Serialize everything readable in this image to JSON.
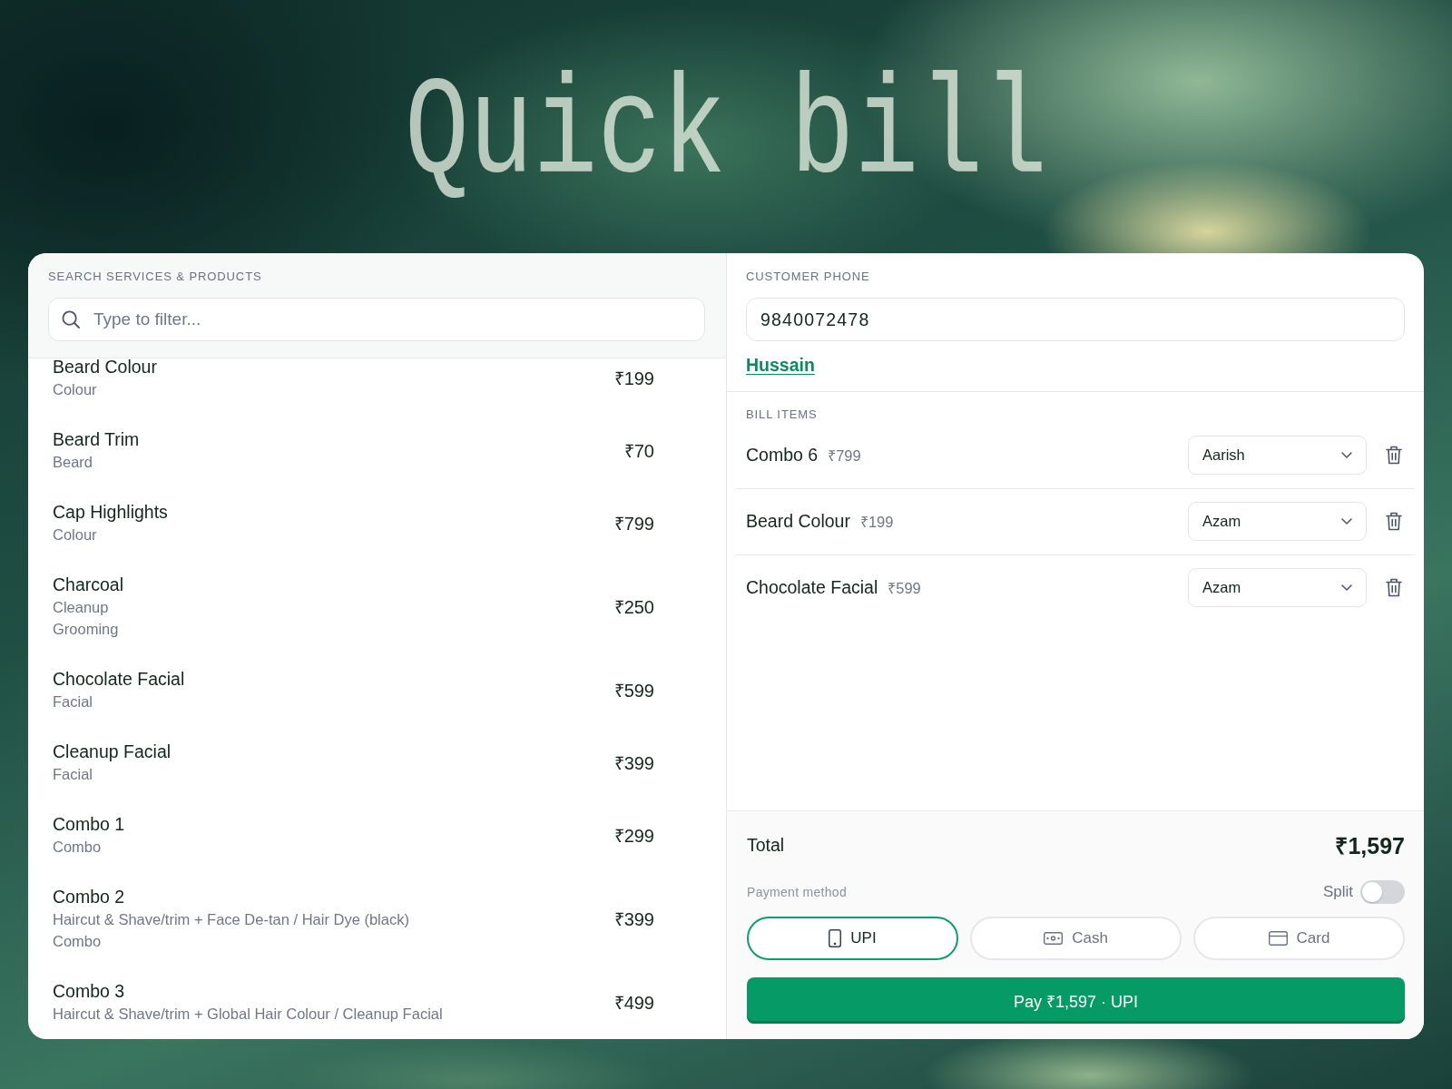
{
  "title": "Quick bill",
  "search_panel": {
    "label": "SEARCH SERVICES & PRODUCTS",
    "search": {
      "placeholder": "Type to filter..."
    },
    "items": [
      {
        "name": "Beard Colour",
        "details": [
          "Colour"
        ],
        "price": "₹199"
      },
      {
        "name": "Beard Trim",
        "details": [
          "Beard"
        ],
        "price": "₹70"
      },
      {
        "name": "Cap Highlights",
        "details": [
          "Colour"
        ],
        "price": "₹799"
      },
      {
        "name": "Charcoal",
        "details": [
          "Cleanup",
          "Grooming"
        ],
        "price": "₹250"
      },
      {
        "name": "Chocolate Facial",
        "details": [
          "Facial"
        ],
        "price": "₹599"
      },
      {
        "name": "Cleanup Facial",
        "details": [
          "Facial"
        ],
        "price": "₹399"
      },
      {
        "name": "Combo 1",
        "details": [
          "Combo"
        ],
        "price": "₹299"
      },
      {
        "name": "Combo 2",
        "details": [
          "Haircut & Shave/trim + Face De-tan / Hair Dye (black)",
          "Combo"
        ],
        "price": "₹399"
      },
      {
        "name": "Combo 3",
        "details": [
          "Haircut & Shave/trim + Global Hair Colour / Cleanup Facial"
        ],
        "price": "₹499"
      }
    ]
  },
  "bill_panel": {
    "customer": {
      "label": "CUSTOMER PHONE",
      "phone": "9840072478",
      "name": "Hussain"
    },
    "items_label": "BILL ITEMS",
    "items": [
      {
        "name": "Combo 6",
        "price": "₹799",
        "staff": "Aarish"
      },
      {
        "name": "Beard Colour",
        "price": "₹199",
        "staff": "Azam"
      },
      {
        "name": "Chocolate Facial",
        "price": "₹599",
        "staff": "Azam"
      }
    ]
  },
  "summary": {
    "total_label": "Total",
    "total": "₹1,597",
    "payment_label": "Payment method",
    "split": {
      "label": "Split",
      "on": false
    },
    "methods": [
      {
        "label": "UPI",
        "kind": "phone",
        "selected": true
      },
      {
        "label": "Cash",
        "kind": "cash",
        "selected": false
      },
      {
        "label": "Card",
        "kind": "card",
        "selected": false
      }
    ],
    "pay_button": "Pay ₹1,597 · UPI"
  }
}
